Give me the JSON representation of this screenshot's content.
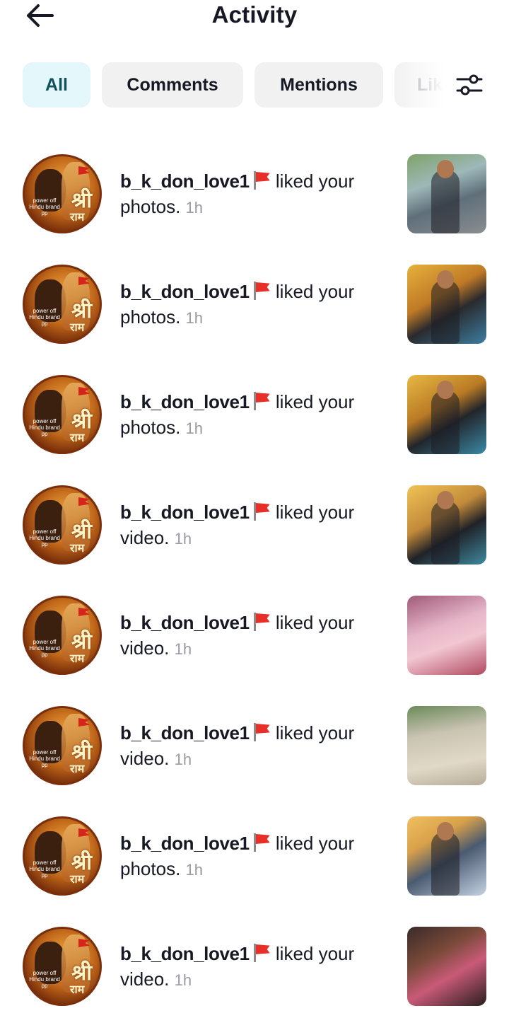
{
  "header": {
    "title": "Activity",
    "back_icon": "arrow-left-icon"
  },
  "tabs": [
    {
      "label": "All",
      "active": true
    },
    {
      "label": "Comments",
      "active": false
    },
    {
      "label": "Mentions",
      "active": false
    },
    {
      "label": "Like",
      "active": false
    }
  ],
  "filter_icon": "sliders-filter-icon",
  "notifications": [
    {
      "username": "b_k_don_love1",
      "action": "liked your",
      "object": "photos.",
      "time": "1h"
    },
    {
      "username": "b_k_don_love1",
      "action": "liked your",
      "object": "photos.",
      "time": "1h"
    },
    {
      "username": "b_k_don_love1",
      "action": "liked your",
      "object": "photos.",
      "time": "1h"
    },
    {
      "username": "b_k_don_love1",
      "action": "liked your",
      "object": "video.",
      "time": "1h"
    },
    {
      "username": "b_k_don_love1",
      "action": "liked your",
      "object": "video.",
      "time": "1h"
    },
    {
      "username": "b_k_don_love1",
      "action": "liked your",
      "object": "video.",
      "time": "1h"
    },
    {
      "username": "b_k_don_love1",
      "action": "liked your",
      "object": "photos.",
      "time": "1h"
    },
    {
      "username": "b_k_don_love1",
      "action": "liked your",
      "object": "video.",
      "time": "1h"
    }
  ],
  "avatar": {
    "text_small": "power off Hindu brand pp",
    "glyph_main": "श्री",
    "glyph_sub": "राम"
  },
  "colors": {
    "active_tab_bg": "#e4f7fb",
    "active_tab_text": "#12515e",
    "tab_bg": "#f1f1f2",
    "text_primary": "#161823",
    "text_secondary": "#9a9aa0"
  }
}
